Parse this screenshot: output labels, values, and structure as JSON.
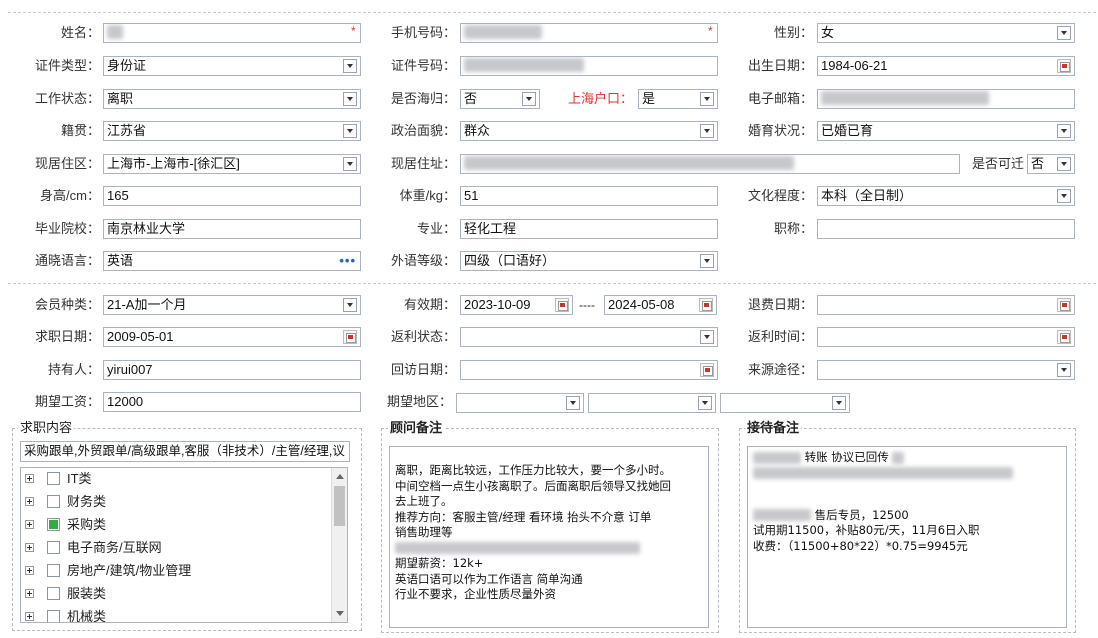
{
  "basic": {
    "name": {
      "label": "姓名：",
      "value": ""
    },
    "phone": {
      "label": "手机号码：",
      "value": ""
    },
    "gender": {
      "label": "性别：",
      "value": "女"
    },
    "id_type": {
      "label": "证件类型：",
      "value": "身份证"
    },
    "id_number": {
      "label": "证件号码：",
      "value": ""
    },
    "birth_date": {
      "label": "出生日期：",
      "value": "1984-06-21"
    },
    "work_status": {
      "label": "工作状态：",
      "value": "离职"
    },
    "returnee": {
      "label": "是否海归：",
      "value": "否"
    },
    "shanghai_hukou": {
      "label": "上海户口：",
      "value": "是"
    },
    "email": {
      "label": "电子邮箱：",
      "value": ""
    },
    "native_place": {
      "label": "籍贯：",
      "value": "江苏省"
    },
    "political": {
      "label": "政治面貌：",
      "value": "群众"
    },
    "marital": {
      "label": "婚育状况：",
      "value": "已婚已育"
    },
    "residence_area": {
      "label": "现居住区：",
      "value": "上海市-上海市-[徐汇区]"
    },
    "residence_addr": {
      "label": "现居住址：",
      "value": ""
    },
    "relocatable": {
      "label": "是否可迁",
      "value": "否"
    },
    "height": {
      "label": "身高/cm：",
      "value": "165"
    },
    "weight": {
      "label": "体重/kg：",
      "value": "51"
    },
    "education": {
      "label": "文化程度：",
      "value": "本科（全日制）"
    },
    "school": {
      "label": "毕业院校：",
      "value": "南京林业大学"
    },
    "major": {
      "label": "专业：",
      "value": "轻化工程"
    },
    "title": {
      "label": "职称：",
      "value": ""
    },
    "language": {
      "label": "通晓语言：",
      "value": "英语",
      "more": "•••"
    },
    "lang_level": {
      "label": "外语等级：",
      "value": "四级（口语好）"
    }
  },
  "member": {
    "member_type": {
      "label": "会员种类：",
      "value": "21-A加一个月"
    },
    "validity": {
      "label": "有效期：",
      "start": "2023-10-09",
      "sep": "----",
      "end": "2024-05-08"
    },
    "refund_date": {
      "label": "退费日期：",
      "value": ""
    },
    "job_date": {
      "label": "求职日期：",
      "value": "2009-05-01"
    },
    "rebate_status": {
      "label": "返利状态：",
      "value": ""
    },
    "rebate_time": {
      "label": "返利时间：",
      "value": ""
    },
    "holder": {
      "label": "持有人：",
      "value": "yirui007"
    },
    "visit_date": {
      "label": "回访日期：",
      "value": ""
    },
    "source": {
      "label": "来源途径：",
      "value": ""
    },
    "expected_salary": {
      "label": "期望工资：",
      "value": "12000"
    },
    "expected_area": {
      "label": "期望地区：",
      "values": [
        "",
        "",
        ""
      ]
    }
  },
  "job_content": {
    "title": "求职内容",
    "summary": "采购跟单,外贸跟单/高级跟单,客服（非技术）/主管/经理,议",
    "categories": [
      {
        "label": "IT类",
        "checked": false
      },
      {
        "label": "财务类",
        "checked": false
      },
      {
        "label": "采购类",
        "checked": true
      },
      {
        "label": "电子商务/互联网",
        "checked": false
      },
      {
        "label": "房地产/建筑/物业管理",
        "checked": false
      },
      {
        "label": "服装类",
        "checked": false
      },
      {
        "label": "机械类",
        "checked": false
      }
    ]
  },
  "advisor_notes": {
    "title": "顾问备注",
    "lines": [
      "离职，距离比较远，工作压力比较大，要一个多小时。",
      "中间空档一点生小孩离职了。后面离职后领导又找她回",
      "去上班了。",
      "推荐方向：客服主管/经理 看环境  抬头不介意 订单",
      "销售助理等",
      "",
      "期望薪资：12k+",
      "英语口语可以作为工作语言 简单沟通",
      "行业不要求，企业性质尽量外资"
    ]
  },
  "reception_notes": {
    "title": "接待备注",
    "line1": "转账 协议已回传",
    "line3": "售后专员，12500",
    "line4": "试用期11500，补贴80元/天，11月6日入职",
    "line5": "收费：（11500+80*22）*0.75=9945元"
  },
  "colors": {
    "border": "#aab3c0",
    "required": "#e03030",
    "checked": "#2dae43",
    "link": "#2a63b8"
  }
}
